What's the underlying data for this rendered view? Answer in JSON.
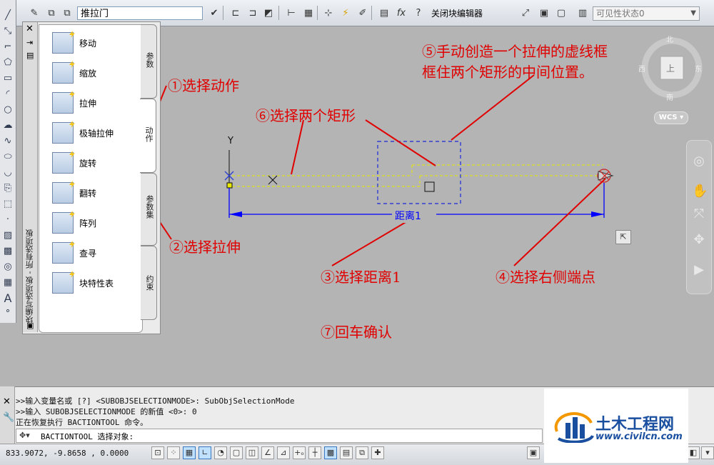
{
  "toolbar": {
    "block_name": "推拉门",
    "close_editor_label": "关闭块编辑器",
    "visibility_state": "可见性状态0"
  },
  "palette": {
    "title": "块编写选项板 - 所有选项板",
    "items": [
      {
        "label": "移动",
        "icon": "move-icon"
      },
      {
        "label": "缩放",
        "icon": "scale-icon"
      },
      {
        "label": "拉伸",
        "icon": "stretch-icon"
      },
      {
        "label": "极轴拉伸",
        "icon": "polar-stretch-icon"
      },
      {
        "label": "旋转",
        "icon": "rotate-icon"
      },
      {
        "label": "翻转",
        "icon": "flip-icon"
      },
      {
        "label": "阵列",
        "icon": "array-icon"
      },
      {
        "label": "查寻",
        "icon": "lookup-icon"
      },
      {
        "label": "块特性表",
        "icon": "block-table-icon"
      }
    ],
    "tabs": [
      "参数",
      "动作",
      "参数集",
      "约束"
    ],
    "active_tab": "动作"
  },
  "drawing": {
    "ucs_y_label": "Y",
    "distance_label": "距离1"
  },
  "annotations": {
    "step1": "①选择动作",
    "step2": "②选择拉伸",
    "step3": "③选择距离1",
    "step4": "④选择右侧端点",
    "step5_line1": "⑤手动创造一个拉伸的虚线框",
    "step5_line2": "框住两个矩形的中间位置。",
    "step6": "⑥选择两个矩形",
    "step7": "⑦回车确认"
  },
  "viewcube": {
    "north": "北",
    "west": "西",
    "east": "东",
    "south": "南",
    "face": "上",
    "wcs": "WCS"
  },
  "command": {
    "lines": [
      ">>输入变量名或 [?] <SUBOBJSELECTIONMODE>: SubObjSelectionMode",
      ">>输入 SUBOBJSELECTIONMODE 的新值 <0>: 0",
      "正在恢复执行 BACTIONTOOL 命令。"
    ],
    "prompt": "BACTIONTOOL 选择对象:"
  },
  "status": {
    "coordinates": "833.9072,  -9.8658  , 0.0000"
  },
  "watermark": {
    "title": "土木工程网",
    "url": "www.civilcn.com"
  },
  "colors": {
    "annotation": "#e00000",
    "canvas": "#b4b4b4",
    "dimension": "#0000ff",
    "dashed_line": "#e8e800"
  }
}
